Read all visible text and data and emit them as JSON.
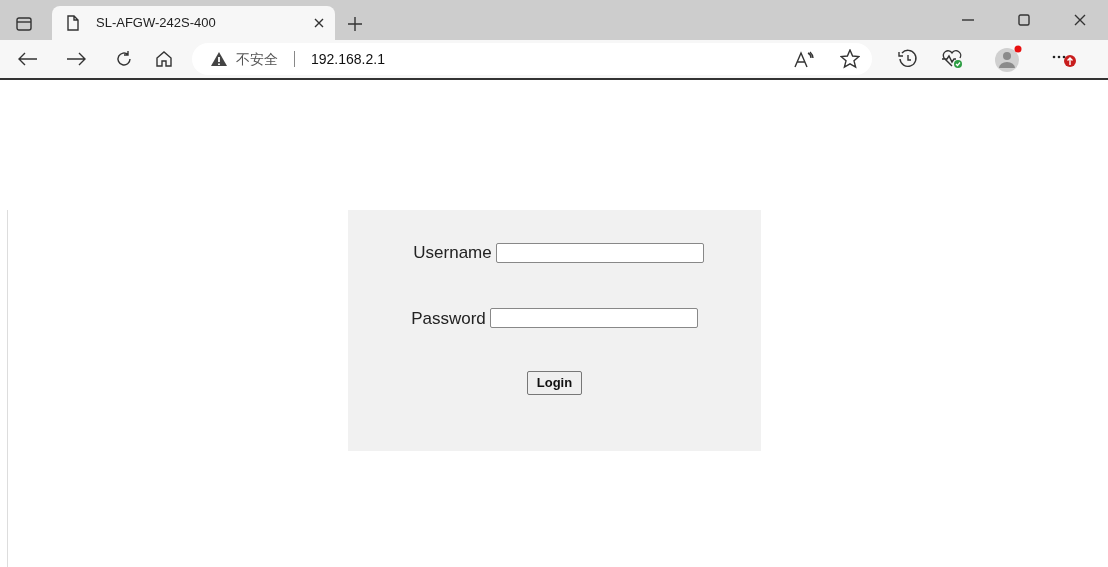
{
  "tab": {
    "title": "SL-AFGW-242S-400"
  },
  "address_bar": {
    "security": "不安全",
    "url": "192.168.2.1"
  },
  "login": {
    "fields": [
      {
        "label": "Username"
      },
      {
        "label": "Password"
      }
    ],
    "button": "Login"
  }
}
